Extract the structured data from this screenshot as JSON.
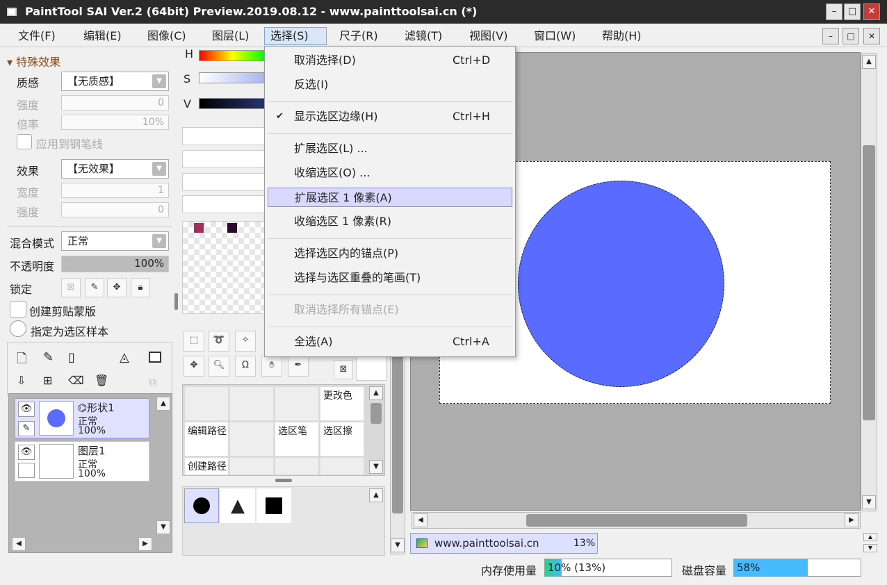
{
  "window": {
    "title": "PaintTool SAI Ver.2 (64bit) Preview.2019.08.12 - www.painttoolsai.cn (*)",
    "min": "–",
    "max": "□",
    "close": "✕"
  },
  "menu": [
    "文件(F)",
    "编辑(E)",
    "图像(C)",
    "图层(L)",
    "选择(S)",
    "尺子(R)",
    "滤镜(T)",
    "视图(V)",
    "窗口(W)",
    "帮助(H)"
  ],
  "effects": {
    "header": "特殊效果",
    "texture_label": "质感",
    "texture_value": "【无质感】",
    "strength_label": "强度",
    "strength_value": "0",
    "scale_label": "倍率",
    "scale_value": "10%",
    "apply_pen": "应用到钢笔线",
    "effect_label": "效果",
    "effect_value": "【无效果】",
    "width_label": "宽度",
    "width_value": "1",
    "strength2_label": "强度",
    "strength2_value": "0"
  },
  "layer_props": {
    "blend_label": "混合模式",
    "blend_value": "正常",
    "opacity_label": "不透明度",
    "opacity_value": "100%",
    "lock_label": "锁定",
    "clip_label": "创建剪贴蒙版",
    "sample_label": "指定为选区样本"
  },
  "layers": [
    {
      "name": "形状1",
      "mode": "正常",
      "opacity": "100%"
    },
    {
      "name": "图层1",
      "mode": "正常",
      "opacity": "100%"
    }
  ],
  "color": {
    "h": "H",
    "s": "S",
    "v": "V",
    "swatch1": "#a0305a",
    "swatch2": "#2a0a2a"
  },
  "tools": {
    "change_color": "更改色",
    "edit_path": "编辑路径",
    "select_pen": "选区笔",
    "select_eraser": "选区擦",
    "create_path": "创建路径"
  },
  "select_menu": {
    "items": [
      {
        "label": "取消选择(D)",
        "shortcut": "Ctrl+D"
      },
      {
        "label": "反选(I)",
        "shortcut": ""
      },
      {
        "label": "显示选区边缘(H)",
        "shortcut": "Ctrl+H"
      },
      {
        "label": "扩展选区(L) ...",
        "shortcut": ""
      },
      {
        "label": "收缩选区(O) ...",
        "shortcut": ""
      },
      {
        "label": "扩展选区 1 像素(A)",
        "shortcut": ""
      },
      {
        "label": "收缩选区 1 像素(R)",
        "shortcut": ""
      },
      {
        "label": "选择选区内的锚点(P)",
        "shortcut": ""
      },
      {
        "label": "选择与选区重叠的笔画(T)",
        "shortcut": ""
      },
      {
        "label": "取消选择所有锚点(E)",
        "shortcut": ""
      },
      {
        "label": "全选(A)",
        "shortcut": "Ctrl+A"
      }
    ]
  },
  "canvas": {
    "circle_color": "#5a6cff",
    "tab_name": "www.painttoolsai.cn",
    "tab_zoom": "13%"
  },
  "status": {
    "mem_label": "内存使用量",
    "mem_value": "10% (13%)",
    "mem_fill": 0.13,
    "disk_label": "磁盘容量",
    "disk_value": "58%",
    "disk_fill": 0.58
  }
}
